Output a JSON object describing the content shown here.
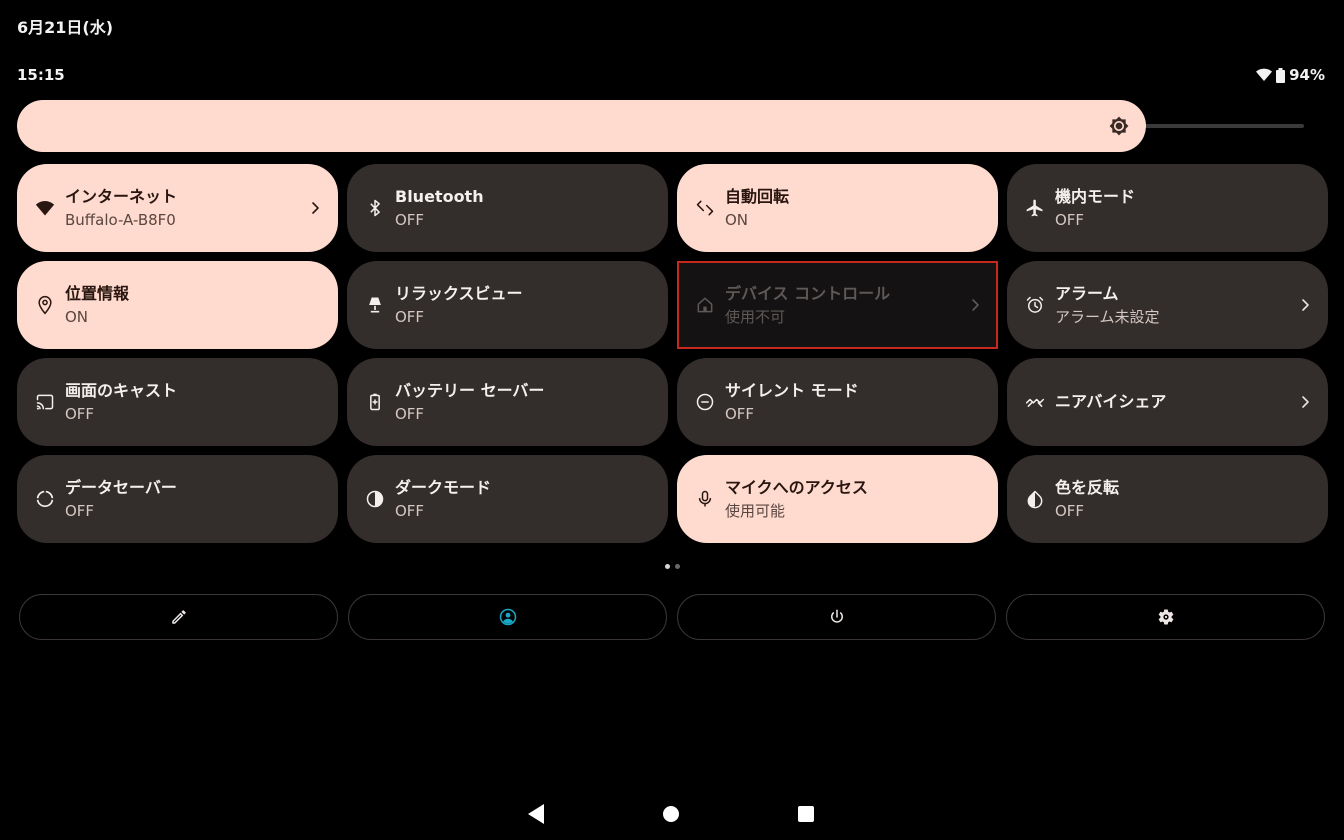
{
  "status_bar": {
    "date": "6月21日(水)",
    "time": "15:15",
    "battery": "94%",
    "icons": [
      "wifi-icon",
      "battery-icon"
    ]
  },
  "brightness": {
    "level": 0.88,
    "icon": "brightness-icon"
  },
  "tiles": [
    {
      "title": "インターネット",
      "subtitle": "Buffalo-A-B8F0",
      "state": "on",
      "icon": "wifi-icon",
      "chevron": true
    },
    {
      "title": "Bluetooth",
      "subtitle": "OFF",
      "state": "off",
      "icon": "bluetooth-icon",
      "chevron": false
    },
    {
      "title": "自動回転",
      "subtitle": "ON",
      "state": "on",
      "icon": "rotate-icon",
      "chevron": false
    },
    {
      "title": "機内モード",
      "subtitle": "OFF",
      "state": "off",
      "icon": "airplane-icon",
      "chevron": false
    },
    {
      "title": "位置情報",
      "subtitle": "ON",
      "state": "on",
      "icon": "location-icon",
      "chevron": false
    },
    {
      "title": "リラックスビュー",
      "subtitle": "OFF",
      "state": "off",
      "icon": "lamp-icon",
      "chevron": false
    },
    {
      "title": "デバイス コントロール",
      "subtitle": "使用不可",
      "state": "disabled",
      "icon": "home-icon",
      "chevron": true
    },
    {
      "title": "アラーム",
      "subtitle": "アラーム未設定",
      "state": "off",
      "icon": "alarm-icon",
      "chevron": true
    },
    {
      "title": "画面のキャスト",
      "subtitle": "OFF",
      "state": "off",
      "icon": "cast-icon",
      "chevron": false
    },
    {
      "title": "バッテリー セーバー",
      "subtitle": "OFF",
      "state": "off",
      "icon": "battery-saver-icon",
      "chevron": false
    },
    {
      "title": "サイレント モード",
      "subtitle": "OFF",
      "state": "off",
      "icon": "do-not-disturb-icon",
      "chevron": false
    },
    {
      "title": "ニアバイシェア",
      "subtitle": "",
      "state": "off",
      "icon": "nearby-share-icon",
      "chevron": true
    },
    {
      "title": "データセーバー",
      "subtitle": "OFF",
      "state": "off",
      "icon": "data-saver-icon",
      "chevron": false
    },
    {
      "title": "ダークモード",
      "subtitle": "OFF",
      "state": "off",
      "icon": "dark-mode-icon",
      "chevron": false
    },
    {
      "title": "マイクへのアクセス",
      "subtitle": "使用可能",
      "state": "on",
      "icon": "microphone-icon",
      "chevron": false
    },
    {
      "title": "色を反転",
      "subtitle": "OFF",
      "state": "off",
      "icon": "invert-colors-icon",
      "chevron": false
    }
  ],
  "pager": {
    "pages": 2,
    "current": 1
  },
  "actions": [
    {
      "icon": "edit-icon"
    },
    {
      "icon": "user-icon"
    },
    {
      "icon": "power-icon"
    },
    {
      "icon": "settings-icon"
    }
  ],
  "navigation": [
    "back-icon",
    "home-icon",
    "recents-icon"
  ],
  "colors": {
    "tile_on": "#ffdbcf",
    "tile_off": "#332d2b",
    "highlight": "#c62a1f",
    "user_accent": "#18a8c4"
  }
}
